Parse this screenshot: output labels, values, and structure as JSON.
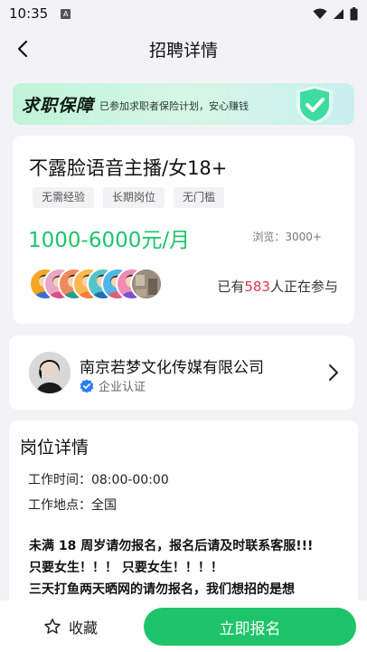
{
  "status_bar": {
    "time": "10:35"
  },
  "nav": {
    "title": "招聘详情"
  },
  "banner": {
    "title": "求职保障",
    "text": "已参加求职者保险计划，安心赚钱"
  },
  "job": {
    "title": "不露脸语音主播/女18+",
    "tags": [
      "无需经验",
      "长期岗位",
      "无门槛"
    ],
    "salary": "1000-6000元/月",
    "views": "浏览：3000+",
    "participants_prefix": "已有",
    "participants_count": "583",
    "participants_suffix": "人正在参与"
  },
  "company": {
    "name": "南京若梦文化传媒有限公司",
    "verify_label": "企业认证"
  },
  "detail": {
    "title": "岗位详情",
    "work_time": "工作时间：08:00-00:00",
    "work_place": "工作地点：全国",
    "body_lines": [
      "未满 18 周岁请勿报名，报名后请及时联系客服!!!",
      "只要女生！！！ 只要女生！！！！",
      "三天打鱼两天晒网的请勿报名，我们想招的是想"
    ]
  },
  "bottom": {
    "favorite_label": "收藏",
    "apply_label": "立即报名"
  },
  "colors": {
    "accent": "#1ec46a",
    "highlight": "#e0344a"
  }
}
